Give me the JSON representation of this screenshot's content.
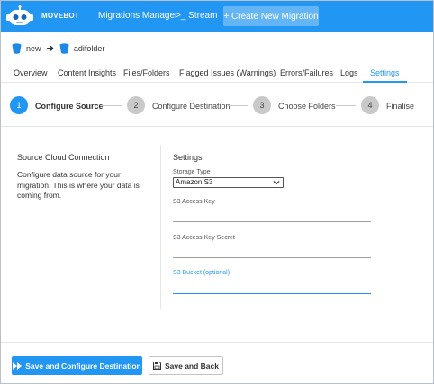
{
  "header": {
    "brand": "MOVEBOT",
    "nav": [
      "Migrations Manager",
      ">_ Stream"
    ],
    "create_button": "+ Create New Migration",
    "accent": "#2196f3"
  },
  "breadcrumb": {
    "source": "new",
    "destination": "adifolder",
    "icon": "bucket-icon"
  },
  "tabs": [
    "Overview",
    "Content Insights",
    "Files/Folders",
    "Flagged Issues (Warnings)",
    "Errors/Failures",
    "Logs",
    "Settings"
  ],
  "active_tab": "Settings",
  "steps": [
    {
      "num": "1",
      "label": "Configure Source",
      "active": true
    },
    {
      "num": "2",
      "label": "Configure Destination",
      "active": false
    },
    {
      "num": "3",
      "label": "Choose Folders",
      "active": false
    },
    {
      "num": "4",
      "label": "Finalise",
      "active": false
    }
  ],
  "left_panel": {
    "title": "Source Cloud Connection",
    "description": "Configure data source for your migration. This is where your data is coming from."
  },
  "settings": {
    "title": "Settings",
    "storage_type_label": "Storage Type",
    "storage_type_value": "Amazon S3",
    "access_key_label": "S3 Access Key",
    "access_key_value": "",
    "secret_label": "S3 Access Key Secret",
    "secret_value": "",
    "bucket_label": "S3 Bucket (optional)",
    "bucket_value": ""
  },
  "footer": {
    "primary_button": "Save and Configure Destination",
    "primary_icon": "fast-forward-icon",
    "secondary_button": "Save and Back",
    "secondary_icon": "save-icon"
  }
}
